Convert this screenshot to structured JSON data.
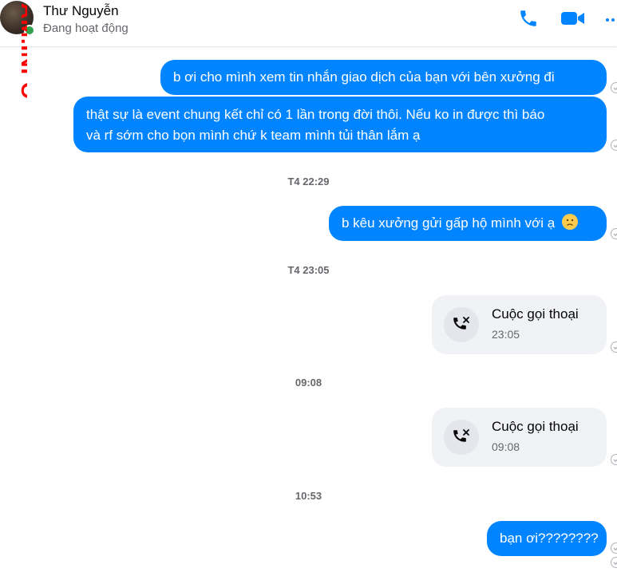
{
  "header": {
    "contact_name": "Thư Nguyễn",
    "status": "Đang hoạt động",
    "icons": [
      "phone-icon",
      "video-call-icon",
      "more-options-icon"
    ],
    "accent_color": "#0084ff",
    "online_color": "#31a24c"
  },
  "watermark": {
    "text": "AM.INFO",
    "color": "#ff0000"
  },
  "messages": [
    {
      "type": "text",
      "text": "b ơi cho  mình xem tin nhắn giao dịch của bạn với bên xưởng đi"
    },
    {
      "type": "text",
      "lines": [
        "thật sự là event chung kết chỉ có 1 lần trong đời thôi. Nếu ko in được thì báo",
        "và rf sớm cho bọn mình chứ k team mình tủi thân lắm ạ"
      ]
    },
    {
      "type": "timestamp",
      "text": "T4 22:29"
    },
    {
      "type": "text",
      "text": "b kêu xưởng gửi gấp hộ mình với ạ",
      "emoji": "😞"
    },
    {
      "type": "timestamp",
      "text": "T4 23:05"
    },
    {
      "type": "call",
      "title": "Cuộc gọi thoại",
      "time": "23:05"
    },
    {
      "type": "timestamp",
      "text": "09:08"
    },
    {
      "type": "call",
      "title": "Cuộc gọi thoại",
      "time": "09:08"
    },
    {
      "type": "timestamp",
      "text": "10:53"
    },
    {
      "type": "text",
      "text": "bạn ơi????????"
    }
  ]
}
